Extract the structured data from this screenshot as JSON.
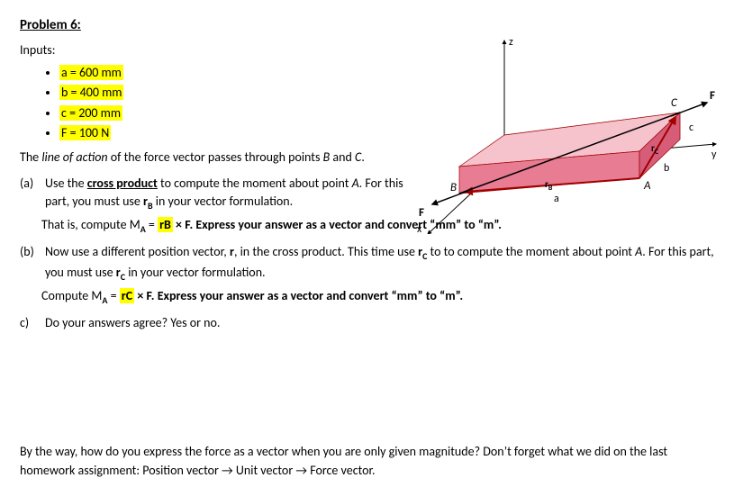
{
  "title": "Problem 6:",
  "inputs_label": "Inputs:",
  "inputs": {
    "a": "a = 600 mm",
    "b": "b = 400 mm",
    "c": "c = 200 mm",
    "F": "F = 100 N"
  },
  "loa_text": "The line of action of the force vector passes through points B and C.",
  "part_a": {
    "label": "(a)",
    "line1": "Use the cross product to compute the moment about point A.  For this part, you must use rB in your vector formulation.",
    "line2_pre": "That is, compute M",
    "line2_sub": "A",
    "line2_mid": " = ",
    "line2_hl": "rB",
    "line2_post": " × F.  Express your answer as a vector and convert “mm” to “m”."
  },
  "part_b": {
    "label": "(b)",
    "line1": "Now use a different position vector, r, in the cross product.  This time use rC to to compute the moment about point A.  For this part, you must use rC in your vector formulation.",
    "line2_pre": "Compute M",
    "line2_sub": "A",
    "line2_mid": " = ",
    "line2_hl": "rC",
    "line2_post": " × F.  Express your answer as a vector and convert “mm” to “m”."
  },
  "part_c": {
    "label": "c)",
    "text": "Do your answers agree?  Yes or no."
  },
  "bottom": "By the way, how do you express the force as a vector when you are only given magnitude?  Don’t forget what we did on the last homework assignment:    Position vector → Unit vector → Force vector.",
  "diagram": {
    "axes": {
      "x": "x",
      "y": "y",
      "z": "z"
    },
    "points": {
      "A": "A",
      "B": "B",
      "C": "C"
    },
    "dims": {
      "a": "a",
      "b": "b",
      "c": "c"
    },
    "vectors": {
      "rB": "rB",
      "rC": "rC",
      "F_top": "F",
      "F_bottom": "F"
    }
  }
}
